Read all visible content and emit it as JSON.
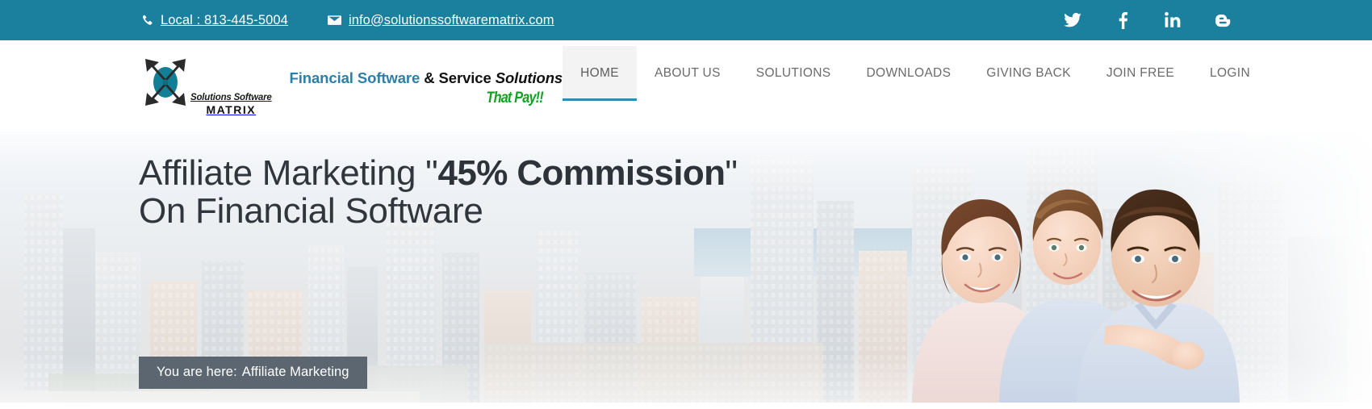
{
  "topbar": {
    "phone": {
      "icon": "phone-icon",
      "label": "Local : 813-445-5004"
    },
    "email": {
      "icon": "envelope-icon",
      "label": "info@solutionssoftwarematrix.com"
    },
    "social": [
      {
        "name": "twitter",
        "label": "Twitter"
      },
      {
        "name": "facebook",
        "label": "Facebook"
      },
      {
        "name": "linkedin",
        "label": "LinkedIn"
      },
      {
        "name": "blogger",
        "label": "Blogger"
      }
    ],
    "background_color": "#1b7f9e",
    "text_color": "#ffffff"
  },
  "header": {
    "logo": {
      "mark": "four-arrows-circle-logo",
      "line1": "Solutions Software",
      "line2": "MATRIX"
    },
    "tagline": {
      "part1": "Financial Software",
      "part2": " & Service ",
      "part3": "Solutions",
      "part4": "That Pay!!",
      "color_part1": "#2d7fa8",
      "color_part4": "#14a021"
    },
    "nav": [
      {
        "label": "HOME",
        "active": true
      },
      {
        "label": "ABOUT US",
        "active": false
      },
      {
        "label": "SOLUTIONS",
        "active": false
      },
      {
        "label": "DOWNLOADS",
        "active": false
      },
      {
        "label": "GIVING BACK",
        "active": false
      },
      {
        "label": "JOIN FREE",
        "active": false
      },
      {
        "label": "LOGIN",
        "active": false
      }
    ],
    "active_accent_color": "#2b8fad"
  },
  "hero": {
    "heading_line1_a": "Affiliate Marketing ",
    "heading_line1_quote_open": "\"",
    "heading_line1_strong": "45% Commission",
    "heading_line1_quote_close": "\"",
    "heading_line2": "On Financial Software",
    "background_image": "city-skyline-photo",
    "foreground_image": "family-photo",
    "text_color": "#31363c"
  },
  "breadcrumb": {
    "prefix": "You are here:",
    "current": "Affiliate Marketing",
    "background_color": "#5c6670"
  }
}
